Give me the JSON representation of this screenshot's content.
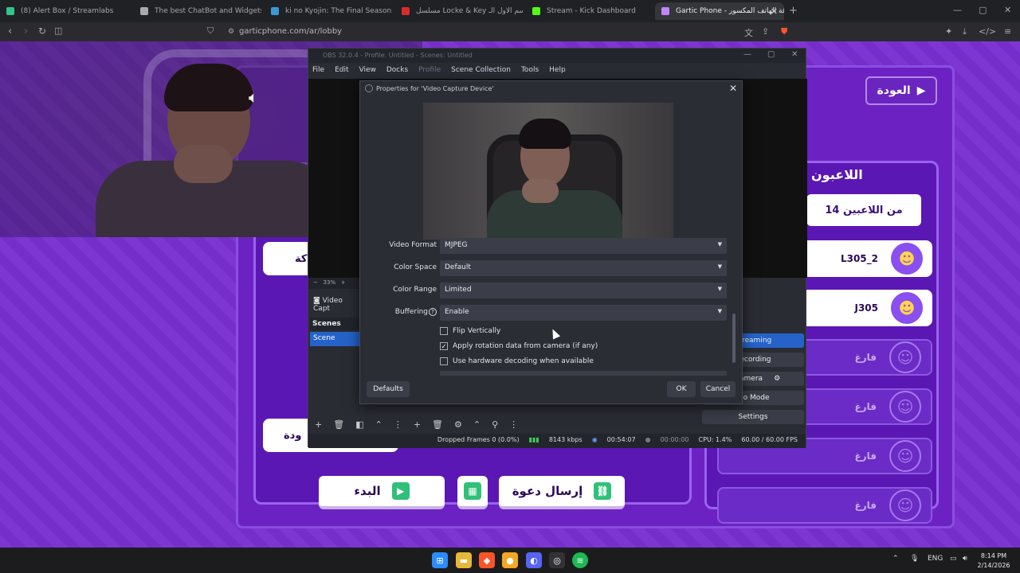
{
  "browser": {
    "tabs": [
      {
        "label": "(8) Alert Box / Streamlabs",
        "color": "#31c48d"
      },
      {
        "label": "The best ChatBot and Widgets for K",
        "color": "#aaaaaa"
      },
      {
        "label": "ki no Kyojin: The Final Season انمي",
        "color": "#3a9ad9"
      },
      {
        "label": "مسلسل Locke & Key الموسم الاول الـ",
        "color": "#d92b2b"
      },
      {
        "label": "Stream - Kick Dashboard",
        "color": "#53fc18"
      },
      {
        "label": "Gartic Phone - قة الهاتف المكسور",
        "color": "#c084fc"
      }
    ],
    "url": "garticphone.com/ar/lobby",
    "accent": "#7a2fd1"
  },
  "gartic": {
    "back_label": "العودة",
    "players_title": "اللاعبون",
    "players_count": "14 من اللاعبين",
    "players": [
      {
        "name": "L305_2",
        "empty": false
      },
      {
        "name": "J305",
        "empty": false
      },
      {
        "name": "فارغ",
        "empty": true
      },
      {
        "name": "فارغ",
        "empty": true
      },
      {
        "name": "فارغ",
        "empty": true
      },
      {
        "name": "فارغ",
        "empty": true
      }
    ],
    "left_cards": [
      "كة",
      "ودة"
    ],
    "start_label": "البدء",
    "invite_label": "إرسال دعوة"
  },
  "obs": {
    "title": "OBS 32.0.4 - Profile: Untitled - Scenes: Untitled",
    "menu": [
      "File",
      "Edit",
      "View",
      "Docks",
      "Profile",
      "Scene Collection",
      "Tools",
      "Help"
    ],
    "zoom": "33%",
    "source_label": "Video Capt",
    "scenes_header": "Scenes",
    "scene_item": "Scene",
    "controls": {
      "streaming": "Streaming",
      "recording": "Recording",
      "virtual_camera": "al Camera",
      "studio_mode": "dio Mode",
      "settings": "Settings"
    },
    "status": {
      "dropped": "Dropped Frames 0 (0.0%)",
      "bitrate": "8143 kbps",
      "stream_time": "00:54:07",
      "rec_time": "00:00:00",
      "cpu": "CPU: 1.4%",
      "fps": "60.00 / 60.00 FPS"
    }
  },
  "dialog": {
    "title": "Properties for 'Video Capture Device'",
    "rows": [
      {
        "label": "Video Format",
        "value": "MJPEG"
      },
      {
        "label": "Color Space",
        "value": "Default"
      },
      {
        "label": "Color Range",
        "value": "Limited"
      },
      {
        "label": "Buffering",
        "value": "Enable"
      }
    ],
    "checkboxes": [
      {
        "label": "Flip Vertically",
        "checked": false
      },
      {
        "label": "Apply rotation data from camera (if any)",
        "checked": true
      },
      {
        "label": "Use hardware decoding when available",
        "checked": false
      }
    ],
    "defaults_label": "Defaults",
    "ok_label": "OK",
    "cancel_label": "Cancel"
  },
  "taskbar": {
    "lang": "ENG",
    "time": "8:14 PM",
    "date": "2/14/2026"
  }
}
